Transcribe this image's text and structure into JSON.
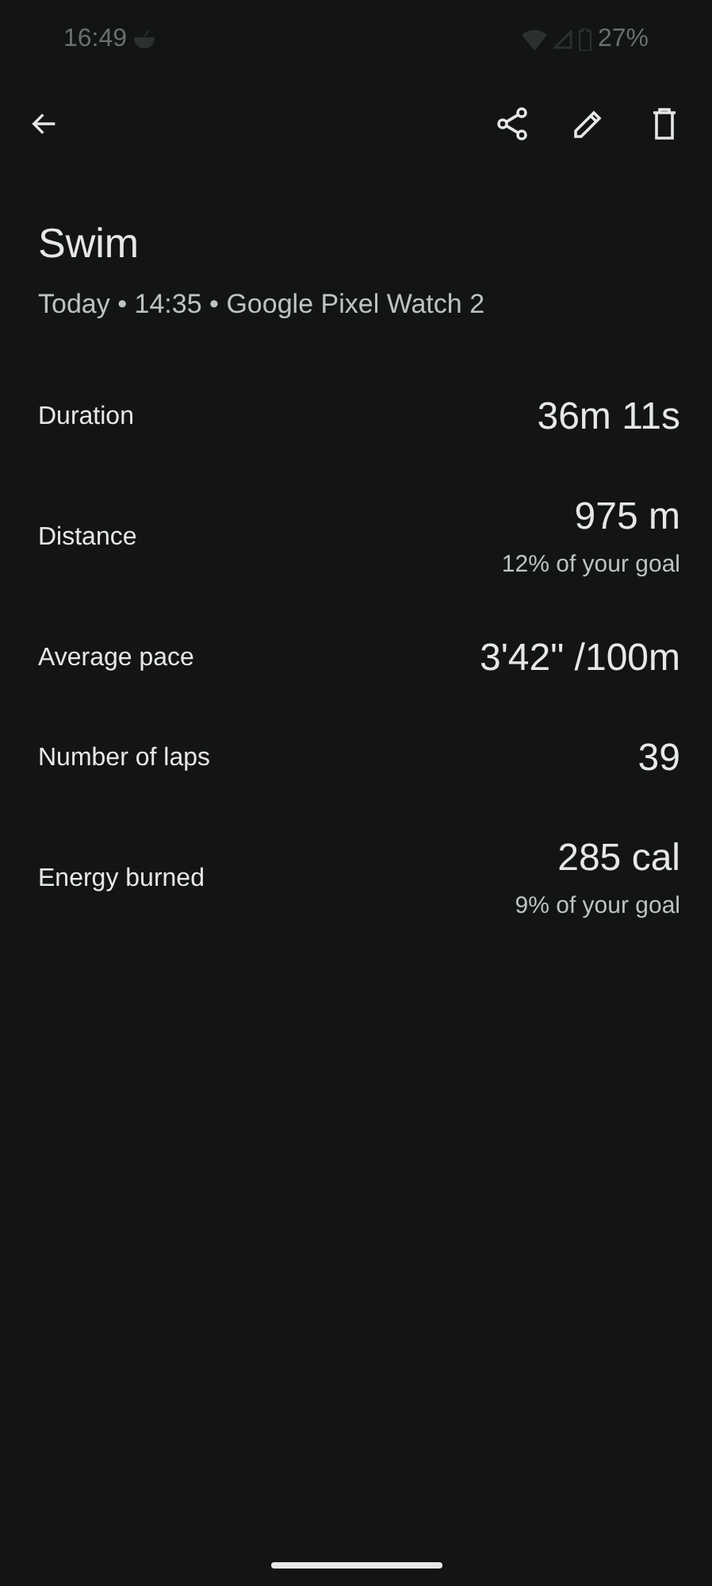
{
  "status_bar": {
    "time": "16:49",
    "battery": "27%"
  },
  "title": "Swim",
  "subtitle": "Today • 14:35 • Google Pixel Watch 2",
  "stats": [
    {
      "label": "Duration",
      "value": "36m 11s"
    },
    {
      "label": "Distance",
      "value": "975 m",
      "goal": "12% of your goal"
    },
    {
      "label": "Average pace",
      "value": "3'42\" /100m"
    },
    {
      "label": "Number of laps",
      "value": "39"
    },
    {
      "label": "Energy burned",
      "value": "285 cal",
      "goal": "9% of your goal"
    }
  ]
}
